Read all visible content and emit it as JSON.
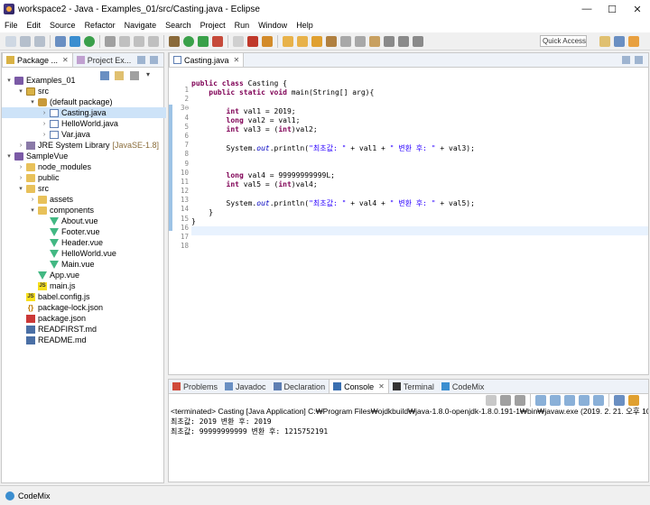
{
  "window": {
    "title": "workspace2 - Java - Examples_01/src/Casting.java - Eclipse",
    "minimize": "—",
    "maximize": "☐",
    "close": "✕"
  },
  "menu": [
    "File",
    "Edit",
    "Source",
    "Refactor",
    "Navigate",
    "Search",
    "Project",
    "Run",
    "Window",
    "Help"
  ],
  "quick_access": {
    "placeholder": "Quick Access"
  },
  "left_panel": {
    "tabs": [
      {
        "label": "Package ...",
        "active": true
      },
      {
        "label": "Project Ex...",
        "active": false
      }
    ],
    "tree": [
      {
        "indent": 0,
        "toggle": "▾",
        "icon": "project-icon",
        "label": "Examples_01"
      },
      {
        "indent": 1,
        "toggle": "▾",
        "icon": "source-folder-icon",
        "label": "src"
      },
      {
        "indent": 2,
        "toggle": "▾",
        "icon": "package-icon",
        "label": "(default package)"
      },
      {
        "indent": 3,
        "toggle": "›",
        "icon": "java-file-icon",
        "label": "Casting.java",
        "selected": true
      },
      {
        "indent": 3,
        "toggle": "›",
        "icon": "java-file-icon",
        "label": "HelloWorld.java"
      },
      {
        "indent": 3,
        "toggle": "›",
        "icon": "java-file-icon",
        "label": "Var.java"
      },
      {
        "indent": 1,
        "toggle": "›",
        "icon": "jre-library-icon",
        "label": "JRE System Library",
        "sub": "[JavaSE-1.8]"
      },
      {
        "indent": 0,
        "toggle": "▾",
        "icon": "project-icon",
        "label": "SampleVue"
      },
      {
        "indent": 1,
        "toggle": "›",
        "icon": "folder-icon",
        "label": "node_modules"
      },
      {
        "indent": 1,
        "toggle": "›",
        "icon": "folder-icon",
        "label": "public"
      },
      {
        "indent": 1,
        "toggle": "▾",
        "icon": "folder-icon",
        "label": "src"
      },
      {
        "indent": 2,
        "toggle": "›",
        "icon": "folder-icon",
        "label": "assets"
      },
      {
        "indent": 2,
        "toggle": "▾",
        "icon": "folder-icon",
        "label": "components"
      },
      {
        "indent": 3,
        "toggle": "",
        "icon": "vue-file-icon",
        "label": "About.vue"
      },
      {
        "indent": 3,
        "toggle": "",
        "icon": "vue-file-icon",
        "label": "Footer.vue"
      },
      {
        "indent": 3,
        "toggle": "",
        "icon": "vue-file-icon",
        "label": "Header.vue"
      },
      {
        "indent": 3,
        "toggle": "",
        "icon": "vue-file-icon",
        "label": "HelloWorld.vue"
      },
      {
        "indent": 3,
        "toggle": "",
        "icon": "vue-file-icon",
        "label": "Main.vue"
      },
      {
        "indent": 2,
        "toggle": "",
        "icon": "vue-file-icon",
        "label": "App.vue"
      },
      {
        "indent": 2,
        "toggle": "",
        "icon": "js-file-icon",
        "label": "main.js"
      },
      {
        "indent": 1,
        "toggle": "",
        "icon": "js-file-icon",
        "label": "babel.config.js"
      },
      {
        "indent": 1,
        "toggle": "",
        "icon": "json-file-icon",
        "label": "package-lock.json"
      },
      {
        "indent": 1,
        "toggle": "",
        "icon": "npm-json-icon",
        "label": "package.json"
      },
      {
        "indent": 1,
        "toggle": "",
        "icon": "markdown-file-icon",
        "label": "READFIRST.md"
      },
      {
        "indent": 1,
        "toggle": "",
        "icon": "markdown-file-icon",
        "label": "README.md"
      }
    ]
  },
  "editor": {
    "tab_label": "Casting.java",
    "line_numbers": [
      "1",
      "2",
      "3⊖",
      "4",
      "5",
      "6",
      "7",
      "8",
      "9",
      "10",
      "11",
      "12",
      "13",
      "14",
      "15",
      "16",
      "17",
      "18"
    ],
    "code": [
      [],
      [
        {
          "k": "kw",
          "t": "public class "
        },
        {
          "k": "",
          "t": "Casting {"
        }
      ],
      [
        {
          "k": "",
          "t": "    "
        },
        {
          "k": "kw",
          "t": "public static void "
        },
        {
          "k": "",
          "t": "main(String[] arg){"
        }
      ],
      [],
      [
        {
          "k": "",
          "t": "        "
        },
        {
          "k": "kw",
          "t": "int "
        },
        {
          "k": "",
          "t": "val1 = 2019;"
        }
      ],
      [
        {
          "k": "",
          "t": "        "
        },
        {
          "k": "kw",
          "t": "long "
        },
        {
          "k": "",
          "t": "val2 = val1;"
        }
      ],
      [
        {
          "k": "",
          "t": "        "
        },
        {
          "k": "kw",
          "t": "int "
        },
        {
          "k": "",
          "t": "val3 = ("
        },
        {
          "k": "kw",
          "t": "int"
        },
        {
          "k": "",
          "t": ")val2;"
        }
      ],
      [],
      [
        {
          "k": "",
          "t": "        System."
        },
        {
          "k": "fld",
          "t": "out"
        },
        {
          "k": "",
          "t": ".println("
        },
        {
          "k": "str",
          "t": "\"최초값: \""
        },
        {
          "k": "",
          "t": " + val1 + "
        },
        {
          "k": "str",
          "t": "\" 변환 후: \""
        },
        {
          "k": "",
          "t": " + val3);"
        }
      ],
      [],
      [],
      [
        {
          "k": "",
          "t": "        "
        },
        {
          "k": "kw",
          "t": "long "
        },
        {
          "k": "",
          "t": "val4 = 99999999999L;"
        }
      ],
      [
        {
          "k": "",
          "t": "        "
        },
        {
          "k": "kw",
          "t": "int "
        },
        {
          "k": "",
          "t": "val5 = ("
        },
        {
          "k": "kw",
          "t": "int"
        },
        {
          "k": "",
          "t": ")val4;"
        }
      ],
      [],
      [
        {
          "k": "",
          "t": "        System."
        },
        {
          "k": "fld",
          "t": "out"
        },
        {
          "k": "",
          "t": ".println("
        },
        {
          "k": "str",
          "t": "\"최초값: \""
        },
        {
          "k": "",
          "t": " + val4 + "
        },
        {
          "k": "str",
          "t": "\" 변환 후: \""
        },
        {
          "k": "",
          "t": " + val5);"
        }
      ],
      [
        {
          "k": "",
          "t": "    }"
        }
      ],
      [
        {
          "k": "",
          "t": "}"
        }
      ],
      []
    ]
  },
  "bottom_panel": {
    "tabs": [
      {
        "label": "Problems",
        "active": false,
        "icon": "problems-icon"
      },
      {
        "label": "Javadoc",
        "active": false,
        "icon": "javadoc-icon"
      },
      {
        "label": "Declaration",
        "active": false,
        "icon": "declaration-icon"
      },
      {
        "label": "Console",
        "active": true,
        "icon": "console-icon"
      },
      {
        "label": "Terminal",
        "active": false,
        "icon": "terminal-icon"
      },
      {
        "label": "CodeMix",
        "active": false,
        "icon": "codemix-icon"
      }
    ],
    "terminated": "<terminated> Casting [Java Application] C:₩Program Files₩ojdkbuild₩java-1.8.0-openjdk-1.8.0.191-1₩bin₩javaw.exe (2019. 2. 21. 오후 10:26:30)",
    "output": [
      "최초값: 2019 변환 후: 2019",
      "최초값: 99999999999 변환 후: 1215752191"
    ]
  },
  "status_bar": {
    "label": "CodeMix"
  },
  "colors": {
    "keyword": "#7f0055",
    "string": "#2a00ff",
    "field": "#0000c0",
    "accent": "#3b8ed0"
  }
}
